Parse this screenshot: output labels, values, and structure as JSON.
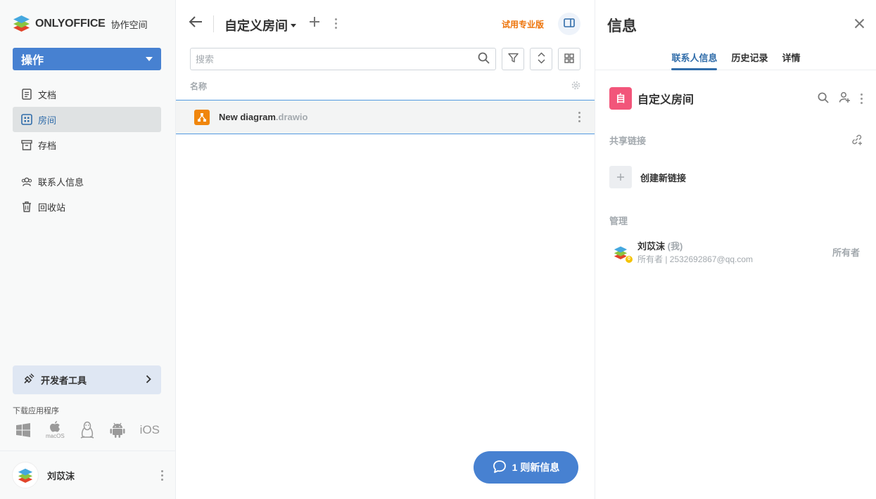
{
  "sidebar": {
    "brand": "ONLYOFFICE",
    "brand_sub": "协作空间",
    "action_label": "操作",
    "nav": [
      {
        "label": "文档",
        "icon": "document-icon"
      },
      {
        "label": "房间",
        "icon": "rooms-icon",
        "active": true
      },
      {
        "label": "存档",
        "icon": "archive-icon"
      },
      {
        "label": "联系人信息",
        "icon": "contacts-icon"
      },
      {
        "label": "回收站",
        "icon": "trash-icon"
      }
    ],
    "dev_tools": "开发者工具",
    "download_label": "下载应用程序",
    "os": [
      "windows",
      "macOS",
      "linux",
      "android",
      "iOS"
    ],
    "macos_label": "macOS",
    "ios_label": "iOS",
    "user_name": "刘苡沫"
  },
  "main": {
    "room_title": "自定义房间",
    "trial_label": "试用专业版",
    "search_placeholder": "搜索",
    "column_name": "名称",
    "files": [
      {
        "name": "New diagram",
        "ext": ".drawio"
      }
    ],
    "chat_label": "1 则新信息"
  },
  "info": {
    "title": "信息",
    "tabs": [
      "联系人信息",
      "历史记录",
      "详情"
    ],
    "active_tab": 0,
    "room_badge": "自",
    "room_name": "自定义房间",
    "shared_links_label": "共享链接",
    "create_link_label": "创建新链接",
    "admin_label": "管理",
    "member": {
      "name": "刘苡沫",
      "me": "(我)",
      "sub": "所有者 | 2532692867@qq.com",
      "role": "所有者",
      "badge": "0"
    }
  },
  "colors": {
    "accent": "#4781d1",
    "link_blue": "#316daa",
    "trial_orange": "#ed7309",
    "room_badge": "#f2557a",
    "file_icon": "#f0860c"
  }
}
